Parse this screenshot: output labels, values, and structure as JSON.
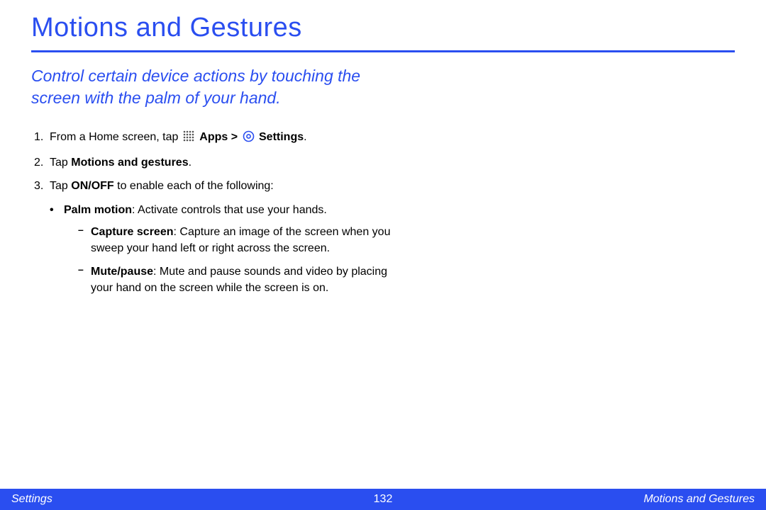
{
  "title": "Motions and Gestures",
  "subtitle": "Control certain device actions by touching the screen with the palm of your hand.",
  "steps": {
    "s1_pre": "From a Home screen, tap ",
    "s1_apps": "Apps",
    "s1_gt": " > ",
    "s1_settings": "Settings",
    "s1_post": ".",
    "s2_pre": "Tap ",
    "s2_bold": "Motions and gestures",
    "s2_post": ".",
    "s3_pre": "Tap ",
    "s3_bold": "ON/OFF",
    "s3_post": " to enable each of the following:"
  },
  "bullets": {
    "palm_label": "Palm motion",
    "palm_text": ": Activate controls that use your hands.",
    "capture_label": "Capture screen",
    "capture_text": ": Capture an image of the screen when you sweep your hand left or right across the screen.",
    "mute_label": "Mute/pause",
    "mute_text": ": Mute and pause sounds and video by placing your hand on the screen while the screen is on."
  },
  "footer": {
    "left": "Settings",
    "center": "132",
    "right": "Motions and Gestures"
  }
}
